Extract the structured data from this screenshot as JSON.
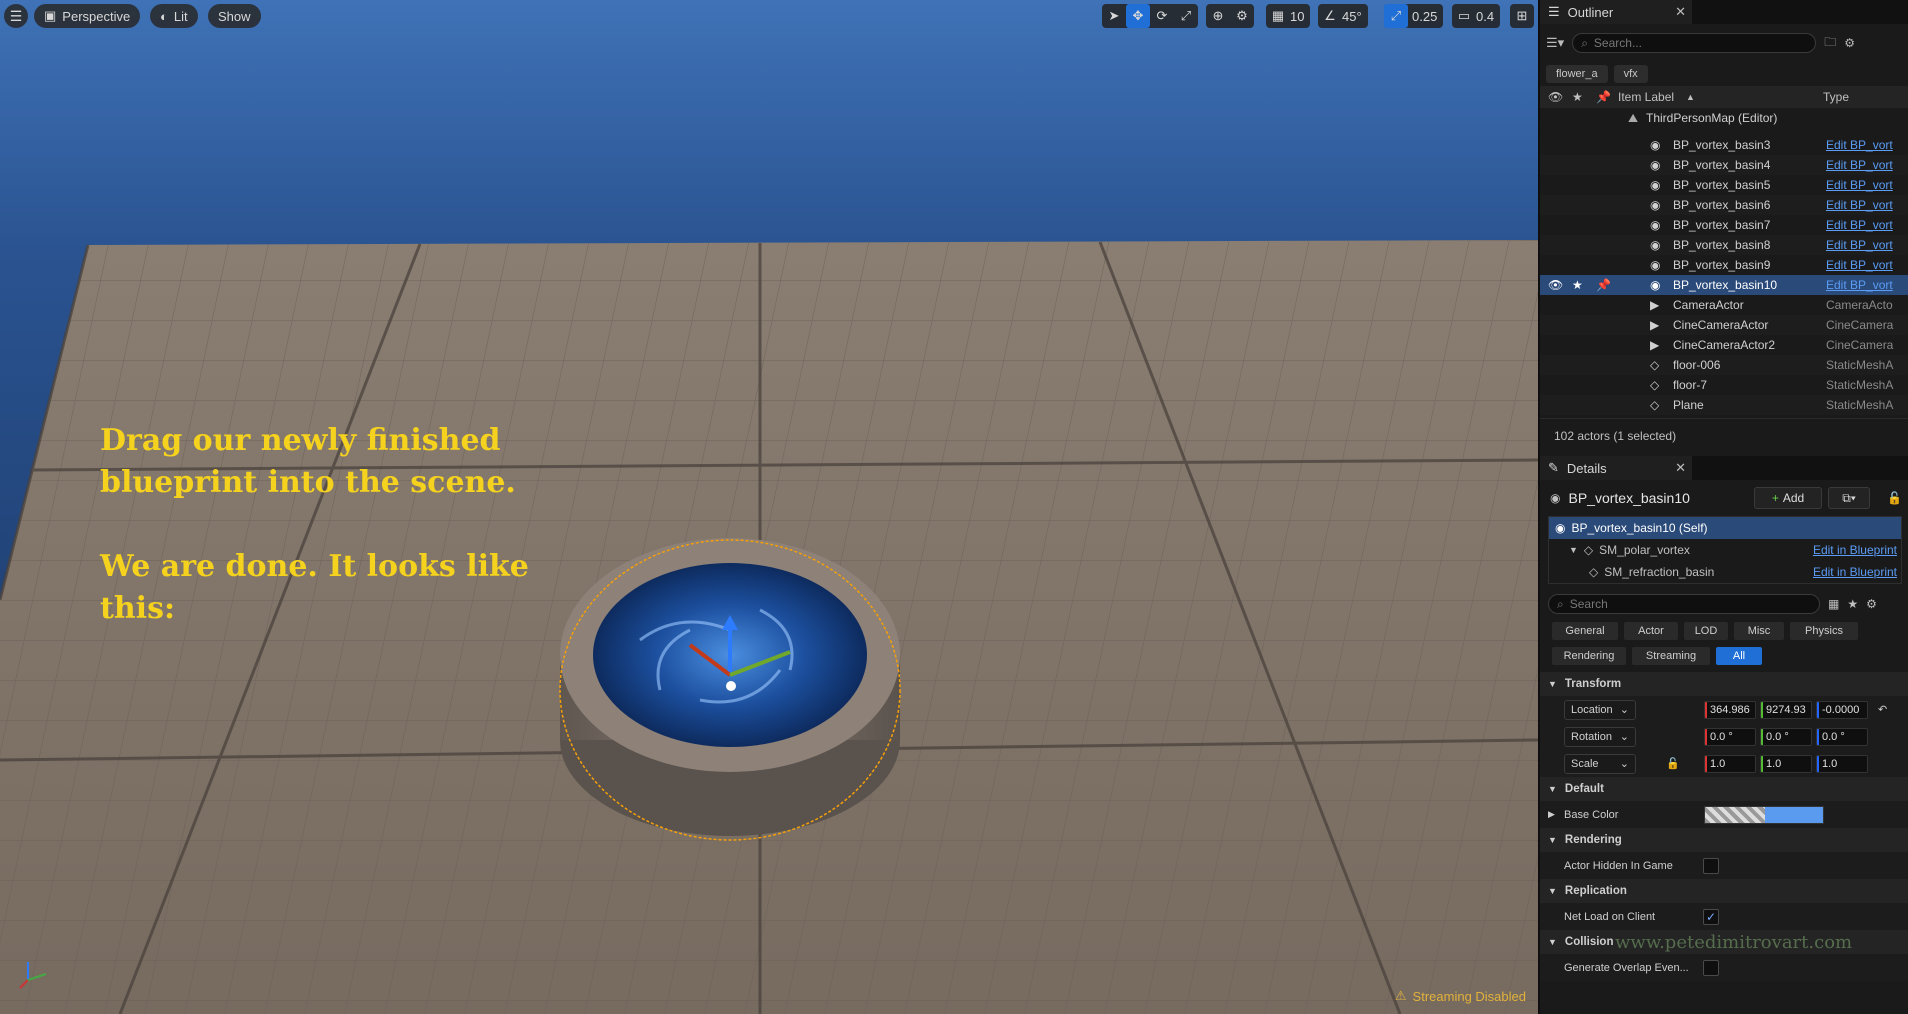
{
  "viewport": {
    "menu_icon": "hamburger-icon",
    "perspective_label": "Perspective",
    "lit_label": "Lit",
    "show_label": "Show",
    "grid_snap_value": "10",
    "angle_snap_value": "45°",
    "scale_snap_value": "0.25",
    "camera_speed_value": "0.4",
    "overlay_line1": "Drag our newly finished",
    "overlay_line2": "blueprint into the scene.",
    "overlay_line3": "We are done. It looks like",
    "overlay_line4": "this:",
    "streaming_status": "Streaming Disabled"
  },
  "outliner": {
    "tab_title": "Outliner",
    "search_placeholder": "Search...",
    "filters": [
      "flower_a",
      "vfx"
    ],
    "col_item_label": "Item Label",
    "col_type": "Type",
    "map_name": "ThirdPersonMap (Editor)",
    "rows": [
      {
        "name": "BP_vortex_basin3",
        "type": "Edit BP_vort",
        "link": true,
        "icon": "blueprint-icon"
      },
      {
        "name": "BP_vortex_basin4",
        "type": "Edit BP_vort",
        "link": true,
        "icon": "blueprint-icon"
      },
      {
        "name": "BP_vortex_basin5",
        "type": "Edit BP_vort",
        "link": true,
        "icon": "blueprint-icon"
      },
      {
        "name": "BP_vortex_basin6",
        "type": "Edit BP_vort",
        "link": true,
        "icon": "blueprint-icon"
      },
      {
        "name": "BP_vortex_basin7",
        "type": "Edit BP_vort",
        "link": true,
        "icon": "blueprint-icon"
      },
      {
        "name": "BP_vortex_basin8",
        "type": "Edit BP_vort",
        "link": true,
        "icon": "blueprint-icon"
      },
      {
        "name": "BP_vortex_basin9",
        "type": "Edit BP_vort",
        "link": true,
        "icon": "blueprint-icon"
      },
      {
        "name": "BP_vortex_basin10",
        "type": "Edit BP_vort",
        "link": true,
        "icon": "blueprint-icon",
        "selected": true
      },
      {
        "name": "CameraActor",
        "type": "CameraActo",
        "link": false,
        "icon": "camera-icon"
      },
      {
        "name": "CineCameraActor",
        "type": "CineCamera",
        "link": false,
        "icon": "cine-camera-icon"
      },
      {
        "name": "CineCameraActor2",
        "type": "CineCamera",
        "link": false,
        "icon": "cine-camera-icon"
      },
      {
        "name": "floor-006",
        "type": "StaticMeshA",
        "link": false,
        "icon": "static-mesh-icon"
      },
      {
        "name": "floor-7",
        "type": "StaticMeshA",
        "link": false,
        "icon": "static-mesh-icon"
      },
      {
        "name": "Plane",
        "type": "StaticMeshA",
        "link": false,
        "icon": "static-mesh-icon"
      }
    ],
    "actor_count": "102 actors (1 selected)"
  },
  "details": {
    "tab_title": "Details",
    "actor_name": "BP_vortex_basin10",
    "add_label": "Add",
    "components": [
      {
        "name": "BP_vortex_basin10 (Self)",
        "link": ""
      },
      {
        "name": "SM_polar_vortex",
        "link": "Edit in Blueprint"
      },
      {
        "name": "SM_refraction_basin",
        "link": "Edit in Blueprint"
      }
    ],
    "search_placeholder": "Search",
    "category_buttons_row1": [
      "General",
      "Actor",
      "LOD",
      "Misc",
      "Physics"
    ],
    "category_buttons_row2": [
      "Rendering",
      "Streaming",
      "All"
    ],
    "active_category": "All",
    "transform_label": "Transform",
    "location_label": "Location",
    "location": {
      "x": "364.986",
      "y": "9274.93",
      "z": "-0.0000"
    },
    "rotation_label": "Rotation",
    "rotation": {
      "x": "0.0 °",
      "y": "0.0 °",
      "z": "0.0 °"
    },
    "scale_label": "Scale",
    "scale": {
      "x": "1.0",
      "y": "1.0",
      "z": "1.0"
    },
    "default_label": "Default",
    "base_color_label": "Base Color",
    "base_color": "#5a9bf0",
    "rendering_label": "Rendering",
    "actor_hidden_label": "Actor Hidden In Game",
    "actor_hidden_checked": false,
    "replication_label": "Replication",
    "net_load_label": "Net Load on Client",
    "net_load_checked": true,
    "collision_label": "Collision",
    "generate_overlap_label": "Generate Overlap Even...",
    "watermark": "www.petedimitrovart.com"
  },
  "colors": {
    "accent": "#1f6fd6",
    "overlay_text": "#f5d21d",
    "selection_outline": "#f5a00a"
  }
}
